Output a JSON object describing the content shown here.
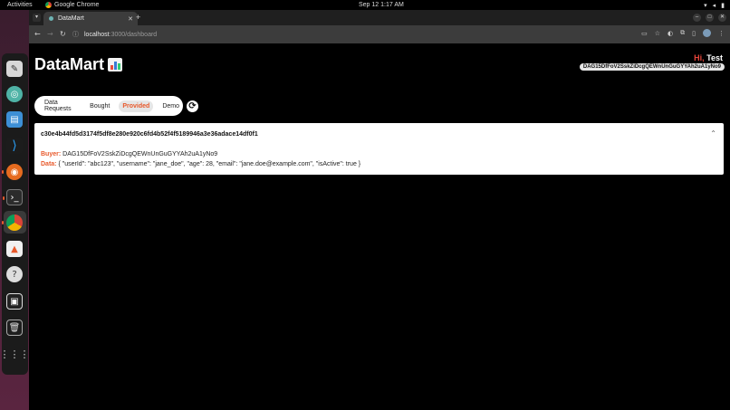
{
  "system": {
    "activities": "Activities",
    "app_name": "Google Chrome",
    "clock": "Sep 12  1:17 AM"
  },
  "browser": {
    "tab_title": "DataMart",
    "url_host": "localhost",
    "url_rest": ":3000/dashboard"
  },
  "app": {
    "logo_text": "DataMart",
    "greeting_hi": "Hi,",
    "greeting_name": "Test",
    "wallet_address": "DAG15DfFoV2SskZiDcgQEWnUnGuGYYAh2uA1yNo9",
    "nav": {
      "tabs": [
        "Data Requests",
        "Bought",
        "Provided",
        "Demo"
      ],
      "active": "Provided"
    }
  },
  "record": {
    "hash": "c30e4b44fd5d3174f5df8e280e920c6fd4b52f4f5189946a3e36adace14df0f1",
    "buyer_label": "Buyer:",
    "buyer_value": "DAG15DfFoV2SskZiDcgQEWnUnGuGYYAh2uA1yNo9",
    "data_label": "Data:",
    "data_value": "{ \"userId\": \"abc123\", \"username\": \"jane_doe\", \"age\": 28, \"email\": \"jane.doe@example.com\", \"isActive\": true }"
  },
  "colors": {
    "accent": "#e8592b",
    "greeting_hi": "#e5443a"
  }
}
